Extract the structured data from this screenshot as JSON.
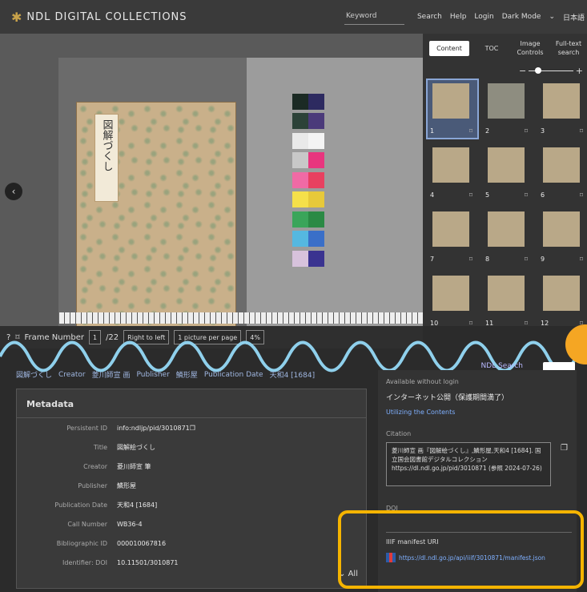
{
  "header": {
    "logo_text": "NDL DIGITAL COLLECTIONS",
    "keyword_placeholder": "Keyword",
    "links": [
      "Search",
      "Help",
      "Login",
      "Dark Mode"
    ],
    "lang": "日本語"
  },
  "panel": {
    "tabs": [
      "Content",
      "TOC",
      "Image Controls",
      "Full-text search"
    ],
    "thumbs": [
      "1",
      "2",
      "3",
      "4",
      "5",
      "6",
      "7",
      "8",
      "9",
      "10",
      "11",
      "12"
    ]
  },
  "toolbar": {
    "frame_label": "Frame Number",
    "frame_value": "1",
    "frame_total": "/22",
    "direction": "Right to left",
    "layout": "1 picture per page",
    "zoom": "4%"
  },
  "title_row": {
    "title": "図解づくし",
    "creator_label": "Creator",
    "creator": "菱川師宣 画",
    "publisher_label": "Publisher",
    "publisher": "鱗形屋",
    "date_label": "Publication Date",
    "date": "天和4 [1684]",
    "ndl_search": "NDL Search"
  },
  "metadata": {
    "heading": "Metadata",
    "rows": [
      {
        "label": "Persistent ID",
        "value": "info:ndljp/pid/3010871"
      },
      {
        "label": "Title",
        "value": "図解絵づくし"
      },
      {
        "label": "Creator",
        "value": "菱川師宣 筆"
      },
      {
        "label": "Publisher",
        "value": "鱗形屋"
      },
      {
        "label": "Publication Date",
        "value": "天和4 [1684]"
      },
      {
        "label": "Call Number",
        "value": "WB36-4"
      },
      {
        "label": "Bibliographic ID",
        "value": "000010067816"
      },
      {
        "label": "Identifier: DOI",
        "value": "10.11501/3010871"
      }
    ],
    "more": "All"
  },
  "right": {
    "avail_line1": "Available without login",
    "avail_line2": "インターネット公開（保護期間満了）",
    "avail_line3": "Utilizing the Contents",
    "citation_label": "Citation",
    "citation_text": "菱川師宣 画『図解絵づくし』,鱗形屋,天和4 [1684]. 国立国会図書館デジタルコレクション https://dl.ndl.go.jp/pid/3010871 (参照 2024-07-26)",
    "doi_label": "DOI",
    "iiif_label": "IIIF manifest URI",
    "iiif_url": "https://dl.ndl.go.jp/api/iiif/3010871/manifest.json"
  },
  "colors": {
    "accent": "#f5b400",
    "wave": "#8fd0ec",
    "orange": "#f5a623"
  }
}
